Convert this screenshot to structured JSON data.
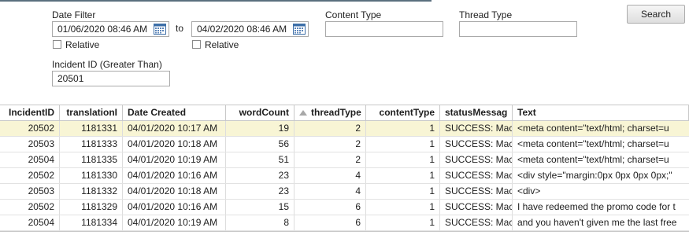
{
  "filters": {
    "date_filter_label": "Date Filter",
    "from_date": "01/06/2020 08:46 AM",
    "to_label": "to",
    "to_date": "04/02/2020 08:46 AM",
    "relative_label": "Relative",
    "content_type_label": "Content Type",
    "content_type_value": "",
    "thread_type_label": "Thread Type",
    "thread_type_value": "",
    "incident_id_label": "Incident ID (Greater Than)",
    "incident_id_value": "20501",
    "search_label": "Search"
  },
  "grid": {
    "columns": [
      "IncidentID",
      "translationI",
      "Date Created",
      "wordCount",
      "threadType",
      "contentType",
      "statusMessag",
      "Text"
    ],
    "sorted_column": "threadType",
    "rows": [
      [
        "20502",
        "1181331",
        "04/01/2020 10:17 AM",
        "19",
        "2",
        "1",
        "SUCCESS: Mac",
        "<meta content=\"text/html; charset=u"
      ],
      [
        "20503",
        "1181333",
        "04/01/2020 10:18 AM",
        "56",
        "2",
        "1",
        "SUCCESS: Mac",
        "<meta content=\"text/html; charset=u"
      ],
      [
        "20504",
        "1181335",
        "04/01/2020 10:19 AM",
        "51",
        "2",
        "1",
        "SUCCESS: Mac",
        "<meta content=\"text/html; charset=u"
      ],
      [
        "20502",
        "1181330",
        "04/01/2020 10:16 AM",
        "23",
        "4",
        "1",
        "SUCCESS: Mac",
        "<div style=\"margin:0px 0px 0px 0px;\""
      ],
      [
        "20503",
        "1181332",
        "04/01/2020 10:18 AM",
        "23",
        "4",
        "1",
        "SUCCESS: Mac",
        "<div>"
      ],
      [
        "20502",
        "1181329",
        "04/01/2020 10:16 AM",
        "15",
        "6",
        "1",
        "SUCCESS: Mac",
        "I have redeemed the promo code for t"
      ],
      [
        "20504",
        "1181334",
        "04/01/2020 10:19 AM",
        "8",
        "6",
        "1",
        "SUCCESS: Mac",
        "and you haven't given me the last free"
      ]
    ],
    "selected_row": 0
  }
}
